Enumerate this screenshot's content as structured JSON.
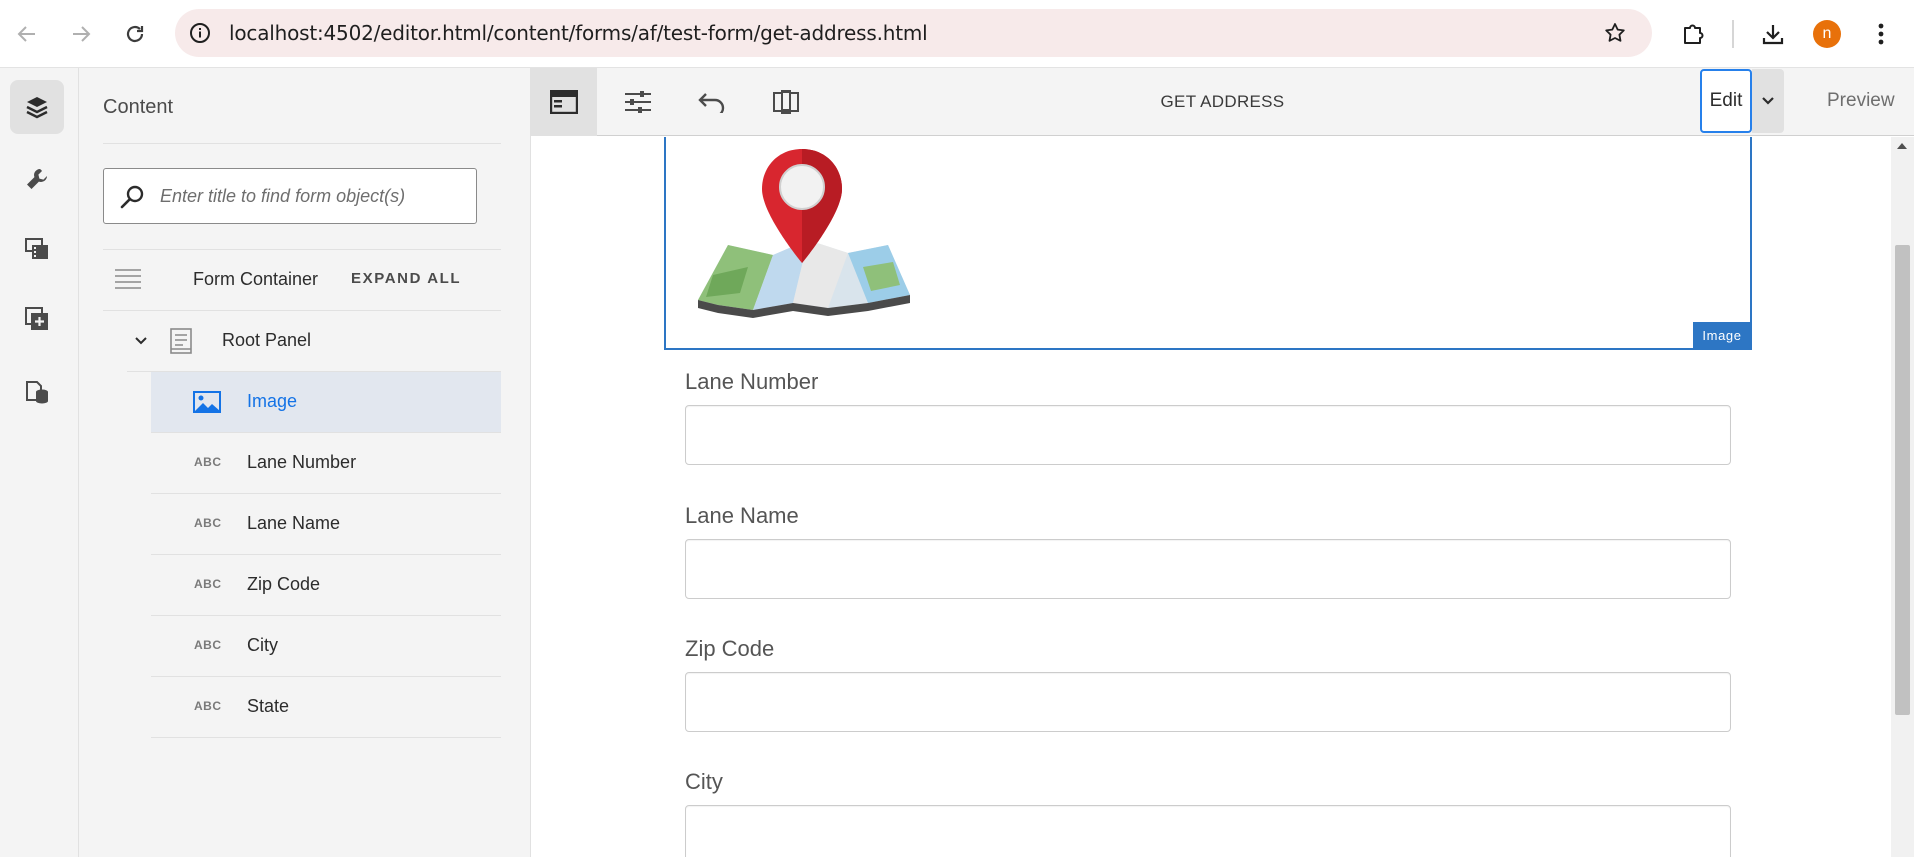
{
  "browser": {
    "url": "localhost:4502/editor.html/content/forms/af/test-form/get-address.html",
    "profile_initial": "n",
    "profile_color": "#e8710a"
  },
  "rail": {
    "items": [
      {
        "icon": "layers-icon",
        "active": true
      },
      {
        "icon": "wrench-icon",
        "active": false
      },
      {
        "icon": "media-icon",
        "active": false
      },
      {
        "icon": "add-component-icon",
        "active": false
      },
      {
        "icon": "data-sources-icon",
        "active": false
      }
    ]
  },
  "panel": {
    "title": "Content",
    "search_placeholder": "Enter title to find form object(s)",
    "tree_root_label": "Form Container",
    "expand_all_label": "EXPAND ALL",
    "root_panel_label": "Root Panel",
    "items": [
      {
        "label": "Image",
        "type": "image",
        "selected": true
      },
      {
        "label": "Lane Number",
        "type": "text",
        "badge": "ABC"
      },
      {
        "label": "Lane Name",
        "type": "text",
        "badge": "ABC"
      },
      {
        "label": "Zip Code",
        "type": "text",
        "badge": "ABC"
      },
      {
        "label": "City",
        "type": "text",
        "badge": "ABC"
      },
      {
        "label": "State",
        "type": "text",
        "badge": "ABC"
      }
    ]
  },
  "toolbar": {
    "title": "GET ADDRESS",
    "edit_label": "Edit",
    "preview_label": "Preview"
  },
  "canvas": {
    "image_tag": "Image",
    "fields": [
      {
        "label": "Lane Number",
        "value": ""
      },
      {
        "label": "Lane Name",
        "value": ""
      },
      {
        "label": "Zip Code",
        "value": ""
      },
      {
        "label": "City",
        "value": ""
      }
    ]
  },
  "colors": {
    "accent": "#2680eb",
    "selection_bg": "#e2e7ef",
    "component_outline": "#2d76c4"
  }
}
